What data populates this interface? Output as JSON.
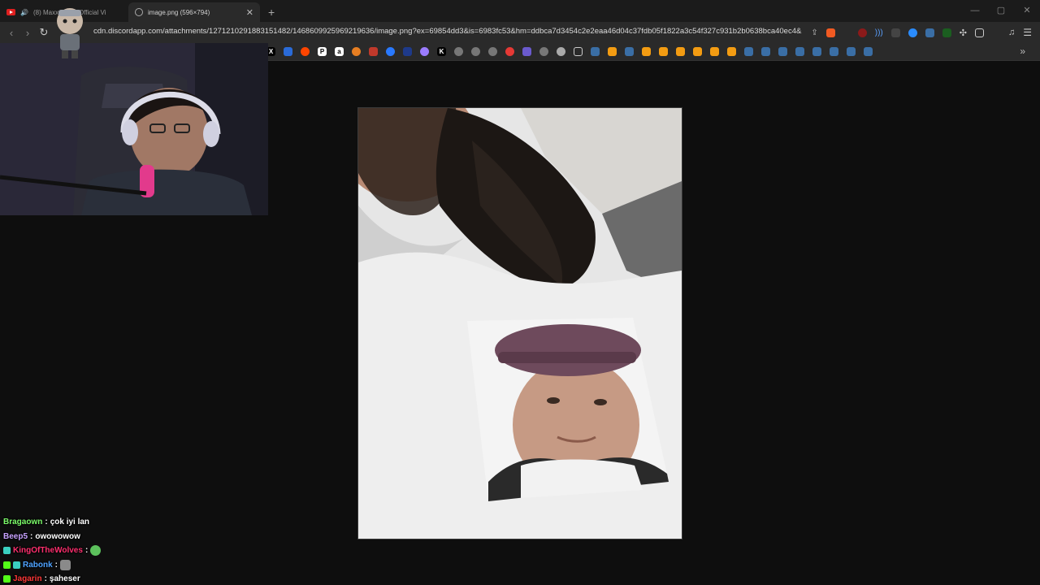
{
  "browser": {
    "tabs": [
      {
        "title": "(8) Maxx - G... (Official Vi",
        "active": false
      },
      {
        "title": "image.png (596×794)",
        "active": true
      }
    ],
    "new_tab_symbol": "+",
    "url": "cdn.discordapp.com/attachments/1271210291883151482/1468609925969219636/image.png?ex=69854dd3&is=6983fc53&hm=ddbca7d3454c2e2eaa46d04c37fdb05f1822a3c54f327c931b2b0638bca40ec4&",
    "window_controls": [
      "—",
      "▢",
      "✕"
    ],
    "accent_colors": {
      "brave": "#f15a22",
      "youtube": "#e02020",
      "bookmark_orange": "#f39c12",
      "steam": "#3a6ea5"
    }
  },
  "bookmarks_overflow": "»",
  "image_viewer": {
    "file": "image.png",
    "natural_size": "596×794"
  },
  "chat": {
    "messages": [
      {
        "user": "Bragaown",
        "color": "#7cfc6a",
        "text": "çok iyi lan"
      },
      {
        "user": "Beep5",
        "color": "#c8a2ff",
        "text": "owowowow"
      },
      {
        "user": "KingOfTheWolves",
        "color": "#ff2f6e",
        "text": ""
      },
      {
        "user": "Rabonk",
        "color": "#4fa3ff",
        "text": ""
      },
      {
        "user": "Jagarin",
        "color": "#ff3838",
        "text": "şaheser"
      }
    ],
    "separator": ":"
  }
}
